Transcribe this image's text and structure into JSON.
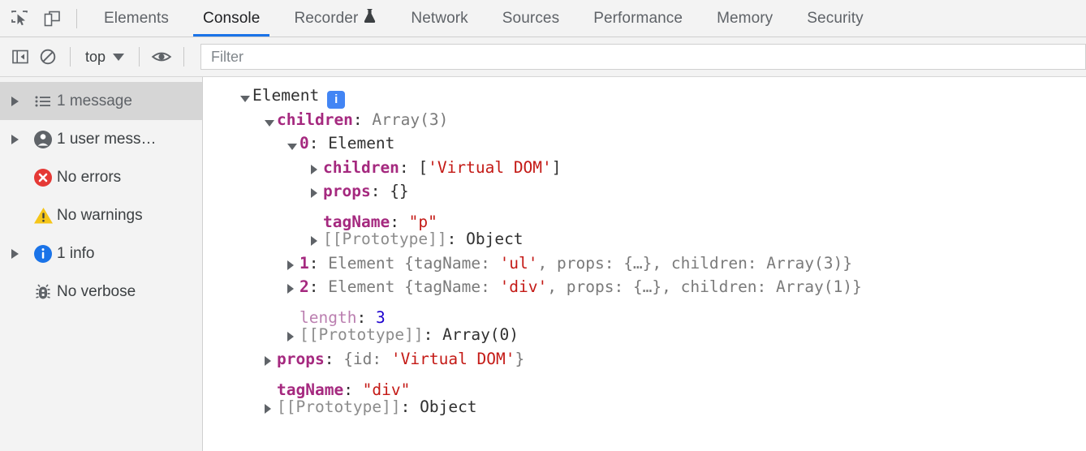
{
  "toolbar": {
    "inspect_icon": "inspect-cursor-icon",
    "device_icon": "device-toolbar-icon",
    "tabs": [
      {
        "label": "Elements",
        "active": false,
        "icon": null
      },
      {
        "label": "Console",
        "active": true,
        "icon": null
      },
      {
        "label": "Recorder",
        "active": false,
        "icon": "flask-icon"
      },
      {
        "label": "Network",
        "active": false,
        "icon": null
      },
      {
        "label": "Sources",
        "active": false,
        "icon": null
      },
      {
        "label": "Performance",
        "active": false,
        "icon": null
      },
      {
        "label": "Memory",
        "active": false,
        "icon": null
      },
      {
        "label": "Security",
        "active": false,
        "icon": null
      }
    ]
  },
  "filterbar": {
    "sidebar_toggle_icon": "show-console-sidebar-icon",
    "clear_icon": "clear-console-icon",
    "context": "top",
    "eye_icon": "live-expression-eye-icon",
    "filter_placeholder": "Filter",
    "filter_value": ""
  },
  "sidebar": {
    "items": [
      {
        "label": "1 message",
        "icon": "list-icon",
        "expandable": true,
        "selected": true
      },
      {
        "label": "1 user mess…",
        "icon": "user-icon",
        "expandable": true,
        "selected": false
      },
      {
        "label": "No errors",
        "icon": "error-icon",
        "expandable": false,
        "selected": false
      },
      {
        "label": "No warnings",
        "icon": "warning-icon",
        "expandable": false,
        "selected": false
      },
      {
        "label": "1 info",
        "icon": "info-icon",
        "expandable": true,
        "selected": false
      },
      {
        "label": "No verbose",
        "icon": "bug-icon",
        "expandable": false,
        "selected": false
      }
    ]
  },
  "console": {
    "lines": [
      {
        "indent": 0,
        "arrow": "down",
        "segments": [
          {
            "t": "Element",
            "c": "plain"
          }
        ],
        "badge": "info-badge"
      },
      {
        "indent": 1,
        "arrow": "down",
        "segments": [
          {
            "t": "children",
            "c": "prop"
          },
          {
            "t": ": ",
            "c": "plain"
          },
          {
            "t": "Array(3)",
            "c": "gray"
          }
        ]
      },
      {
        "indent": 2,
        "arrow": "down",
        "segments": [
          {
            "t": "0",
            "c": "index"
          },
          {
            "t": ": ",
            "c": "plain"
          },
          {
            "t": "Element",
            "c": "plain"
          }
        ]
      },
      {
        "indent": 3,
        "arrow": "right",
        "segments": [
          {
            "t": "children",
            "c": "prop"
          },
          {
            "t": ": ",
            "c": "plain"
          },
          {
            "t": "[",
            "c": "plain"
          },
          {
            "t": "'Virtual DOM'",
            "c": "str"
          },
          {
            "t": "]",
            "c": "plain"
          }
        ]
      },
      {
        "indent": 3,
        "arrow": "right",
        "segments": [
          {
            "t": "props",
            "c": "prop"
          },
          {
            "t": ": ",
            "c": "plain"
          },
          {
            "t": "{}",
            "c": "plain"
          }
        ]
      },
      {
        "indent": 3,
        "arrow": "none",
        "segments": [
          {
            "t": "tagName",
            "c": "prop"
          },
          {
            "t": ": ",
            "c": "plain"
          },
          {
            "t": "\"p\"",
            "c": "str"
          }
        ]
      },
      {
        "indent": 3,
        "arrow": "right",
        "segments": [
          {
            "t": "[[Prototype]]",
            "c": "int"
          },
          {
            "t": ": ",
            "c": "plain"
          },
          {
            "t": "Object",
            "c": "plain"
          }
        ]
      },
      {
        "indent": 2,
        "arrow": "right",
        "segments": [
          {
            "t": "1",
            "c": "index"
          },
          {
            "t": ": ",
            "c": "plain"
          },
          {
            "t": "Element ",
            "c": "gray"
          },
          {
            "t": "{tagName: ",
            "c": "gray"
          },
          {
            "t": "'ul'",
            "c": "str"
          },
          {
            "t": ", props: {…}, children: Array(3)}",
            "c": "gray"
          }
        ]
      },
      {
        "indent": 2,
        "arrow": "right",
        "segments": [
          {
            "t": "2",
            "c": "index"
          },
          {
            "t": ": ",
            "c": "plain"
          },
          {
            "t": "Element ",
            "c": "gray"
          },
          {
            "t": "{tagName: ",
            "c": "gray"
          },
          {
            "t": "'div'",
            "c": "str"
          },
          {
            "t": ", props: {…}, children: Array(1)}",
            "c": "gray"
          }
        ]
      },
      {
        "indent": 2,
        "arrow": "none",
        "segments": [
          {
            "t": "length",
            "c": "len"
          },
          {
            "t": ": ",
            "c": "plain"
          },
          {
            "t": "3",
            "c": "num"
          }
        ]
      },
      {
        "indent": 2,
        "arrow": "right",
        "segments": [
          {
            "t": "[[Prototype]]",
            "c": "int"
          },
          {
            "t": ": ",
            "c": "plain"
          },
          {
            "t": "Array(0)",
            "c": "plain"
          }
        ]
      },
      {
        "indent": 1,
        "arrow": "right",
        "segments": [
          {
            "t": "props",
            "c": "prop"
          },
          {
            "t": ": ",
            "c": "plain"
          },
          {
            "t": "{id: ",
            "c": "gray"
          },
          {
            "t": "'Virtual DOM'",
            "c": "str"
          },
          {
            "t": "}",
            "c": "gray"
          }
        ]
      },
      {
        "indent": 1,
        "arrow": "none",
        "segments": [
          {
            "t": "tagName",
            "c": "prop"
          },
          {
            "t": ": ",
            "c": "plain"
          },
          {
            "t": "\"div\"",
            "c": "str"
          }
        ]
      },
      {
        "indent": 1,
        "arrow": "right",
        "segments": [
          {
            "t": "[[Prototype]]",
            "c": "int"
          },
          {
            "t": ": ",
            "c": "plain"
          },
          {
            "t": "Object",
            "c": "plain"
          }
        ]
      }
    ]
  },
  "colors": {
    "accent": "#1a73e8",
    "error": "#e53935",
    "warning": "#f5c518",
    "info": "#1a73e8",
    "string": "#c41a16",
    "number": "#1c00cf",
    "property": "#a5297f",
    "chrome_bg": "#f3f3f3"
  }
}
